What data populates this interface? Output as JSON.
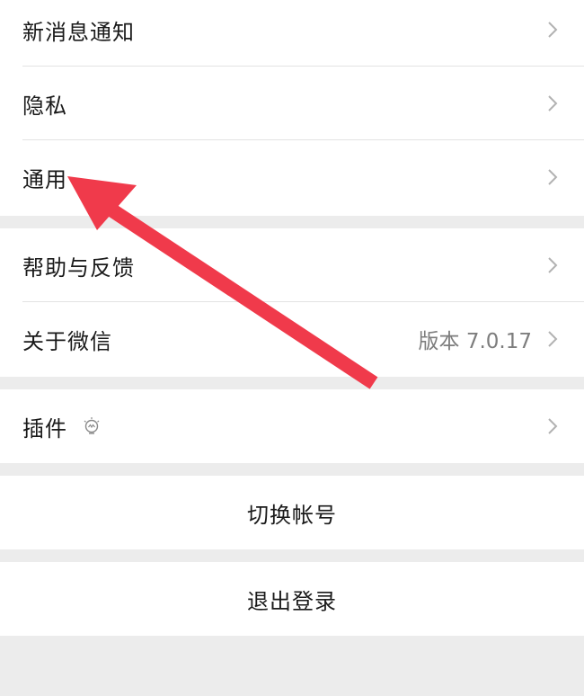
{
  "settings": {
    "group1": [
      {
        "label": "新消息通知"
      },
      {
        "label": "隐私"
      },
      {
        "label": "通用"
      }
    ],
    "group2": [
      {
        "label": "帮助与反馈"
      },
      {
        "label": "关于微信",
        "value": "版本 7.0.17"
      }
    ],
    "group3": [
      {
        "label": "插件"
      }
    ],
    "switch_account_label": "切换帐号",
    "logout_label": "退出登录"
  },
  "colors": {
    "background": "#ececec",
    "row_background": "#ffffff",
    "annotation_arrow": "#f03a4b"
  },
  "icons": {
    "chevron": "chevron-right-icon",
    "plugin": "plugin-lightbulb-icon"
  }
}
